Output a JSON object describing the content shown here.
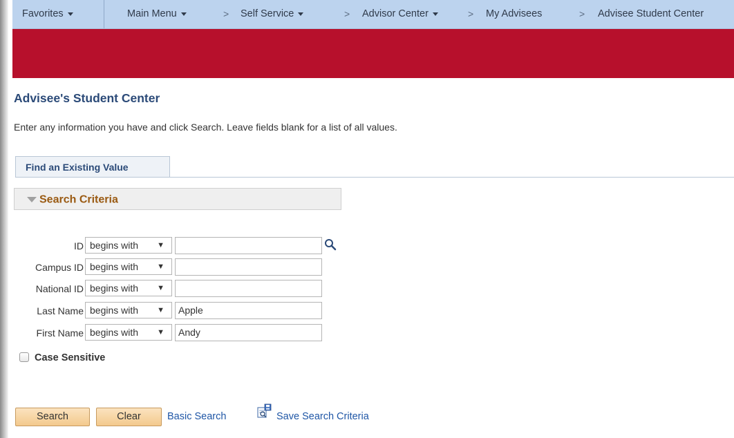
{
  "nav": {
    "favorites": "Favorites",
    "main_menu": "Main Menu",
    "crumbs": [
      "Self Service",
      "Advisor Center",
      "My Advisees",
      "Advisee Student Center"
    ],
    "crumb_sep": ">"
  },
  "page": {
    "title": "Advisee's Student Center",
    "instructions": "Enter any information you have and click Search. Leave fields blank for a list of all values."
  },
  "tabs": [
    {
      "label": "Find an Existing Value"
    }
  ],
  "search_criteria": {
    "header": "Search Criteria",
    "fields": [
      {
        "label": "ID",
        "operator": "begins with",
        "value": ""
      },
      {
        "label": "Campus ID",
        "operator": "begins with",
        "value": ""
      },
      {
        "label": "National ID",
        "operator": "begins with",
        "value": ""
      },
      {
        "label": "Last Name",
        "operator": "begins with",
        "value": "Apple"
      },
      {
        "label": "First Name",
        "operator": "begins with",
        "value": "Andy"
      }
    ],
    "case_sensitive_label": "Case Sensitive",
    "case_sensitive_checked": false
  },
  "actions": {
    "search": "Search",
    "clear": "Clear",
    "basic_search": "Basic Search",
    "save_search_criteria": "Save Search Criteria"
  },
  "colors": {
    "nav_bg": "#bcd3ee",
    "brand_red": "#b7102c",
    "title_blue": "#2b4a78",
    "criteria_orange": "#9a5a12",
    "link_blue": "#1f56a6",
    "button_orange": "#f3c98d"
  },
  "icons": {
    "lookup": "magnifier-icon",
    "save_search": "save-search-icon",
    "collapse": "triangle-down-icon",
    "dropdown": "caret-down-icon"
  }
}
